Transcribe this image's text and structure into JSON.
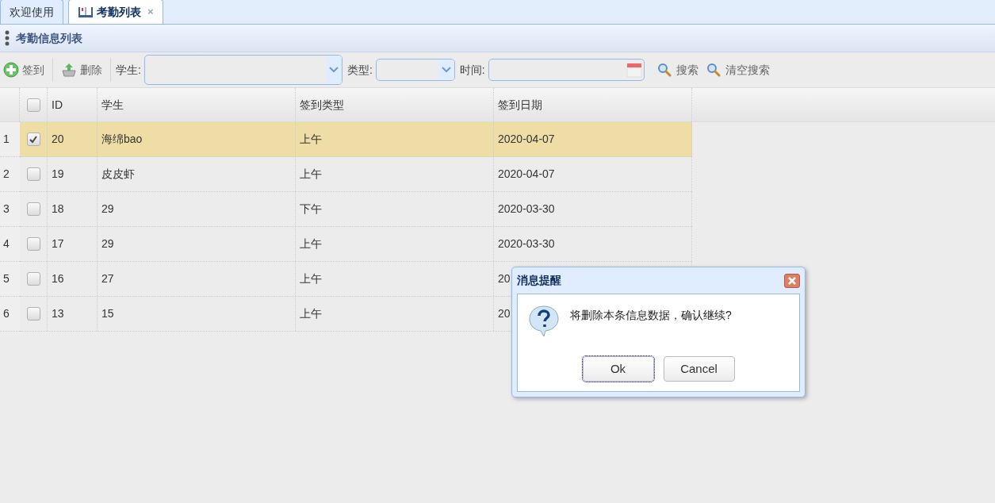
{
  "tabs": [
    {
      "label": "欢迎使用",
      "selected": false
    },
    {
      "label": "考勤列表",
      "selected": true,
      "close": "×"
    }
  ],
  "panel": {
    "title": "考勤信息列表"
  },
  "toolbar": {
    "buttons": [
      {
        "label": "签到",
        "kind": "add"
      },
      {
        "label": "删除",
        "kind": "delete"
      }
    ],
    "filters": [
      {
        "label": "学生:",
        "kind": "combo"
      },
      {
        "label": "类型:",
        "kind": "combo"
      },
      {
        "label": "时间:",
        "kind": "date"
      }
    ],
    "search": [
      {
        "label": "搜索"
      },
      {
        "label": "清空搜索"
      }
    ]
  },
  "table": {
    "all_checked": false,
    "columns": [
      "ID",
      "学生",
      "签到类型",
      "签到日期"
    ],
    "rows": [
      {
        "number": "1",
        "selected": true,
        "checked": true,
        "cells": [
          "20",
          "海绵bao",
          "上午",
          "2020-04-07"
        ]
      },
      {
        "number": "2",
        "selected": false,
        "checked": false,
        "cells": [
          "19",
          "皮皮虾",
          "上午",
          "2020-04-07"
        ]
      },
      {
        "number": "3",
        "selected": false,
        "checked": false,
        "cells": [
          "18",
          "29",
          "下午",
          "2020-03-30"
        ]
      },
      {
        "number": "4",
        "selected": false,
        "checked": false,
        "cells": [
          "17",
          "29",
          "上午",
          "2020-03-30"
        ]
      },
      {
        "number": "5",
        "selected": false,
        "checked": false,
        "cells": [
          "16",
          "27",
          "上午",
          "20"
        ]
      },
      {
        "number": "6",
        "selected": false,
        "checked": false,
        "cells": [
          "13",
          "15",
          "上午",
          "20"
        ]
      }
    ]
  },
  "dialog": {
    "title": "消息提醒",
    "message": "将删除本条信息数据，确认继续?",
    "buttons": [
      {
        "label": "Ok",
        "focused": true
      },
      {
        "label": "Cancel",
        "focused": false
      }
    ]
  }
}
